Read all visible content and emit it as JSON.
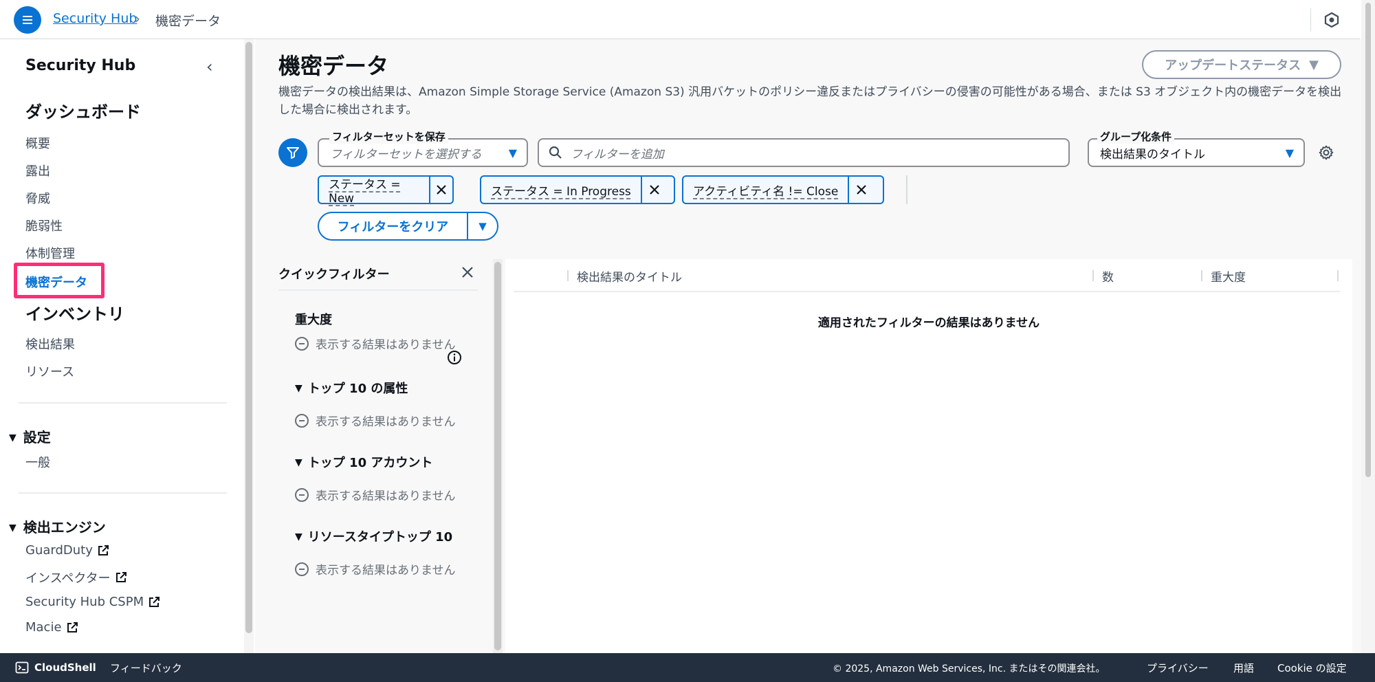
{
  "breadcrumb": {
    "root": "Security Hub",
    "current": "機密データ"
  },
  "sidebar": {
    "title": "Security Hub",
    "dashboard_heading": "ダッシュボード",
    "dashboard_items": [
      "概要",
      "露出",
      "脅威",
      "脆弱性",
      "体制管理",
      "機密データ"
    ],
    "active_item": "機密データ",
    "inventory_heading": "インベントリ",
    "inventory_items": [
      "検出結果",
      "リソース"
    ],
    "settings_section": "設定",
    "settings_items": [
      "一般"
    ],
    "engines_section": "検出エンジン",
    "engine_items": [
      "GuardDuty",
      "インスペクター",
      "Security Hub CSPM",
      "Macie"
    ]
  },
  "main": {
    "title": "機密データ",
    "update_status_label": "アップデートステータス",
    "description": "機密データの検出結果は、Amazon Simple Storage Service (Amazon S3) 汎用バケットのポリシー違反またはプライバシーの侵害の可能性がある場合、または S3 オブジェクト内の機密データを検出した場合に検出されます。",
    "filter_set": {
      "label": "フィルターセットを保存",
      "placeholder": "フィルターセットを選択する"
    },
    "search_placeholder": "フィルターを追加",
    "group_by": {
      "label": "グループ化条件",
      "value": "検出結果のタイトル"
    },
    "tokens": [
      "ステータス = New",
      "ステータス = In Progress",
      "アクティビティ名 != Close"
    ],
    "clear_filters_label": "フィルターをクリア"
  },
  "quick_filters": {
    "title": "クイックフィルター",
    "sections": [
      {
        "heading": "重大度",
        "empty": "表示する結果はありません"
      },
      {
        "heading": "トップ 10 の属性",
        "empty": "表示する結果はありません"
      },
      {
        "heading": "トップ 10 アカウント",
        "empty": "表示する結果はありません"
      },
      {
        "heading": "リソースタイプトップ 10",
        "empty": "表示する結果はありません"
      }
    ]
  },
  "table": {
    "columns": [
      "検出結果のタイトル",
      "数",
      "重大度"
    ],
    "empty_message": "適用されたフィルターの結果はありません"
  },
  "footer": {
    "cloudshell": "CloudShell",
    "feedback": "フィードバック",
    "copyright": "© 2025, Amazon Web Services, Inc. またはその関連会社。",
    "privacy": "プライバシー",
    "terms": "用語",
    "cookie": "Cookie の設定"
  },
  "colors": {
    "accent": "#0972d3",
    "highlight": "#ff2d78",
    "footer_bg": "#232f3e"
  }
}
